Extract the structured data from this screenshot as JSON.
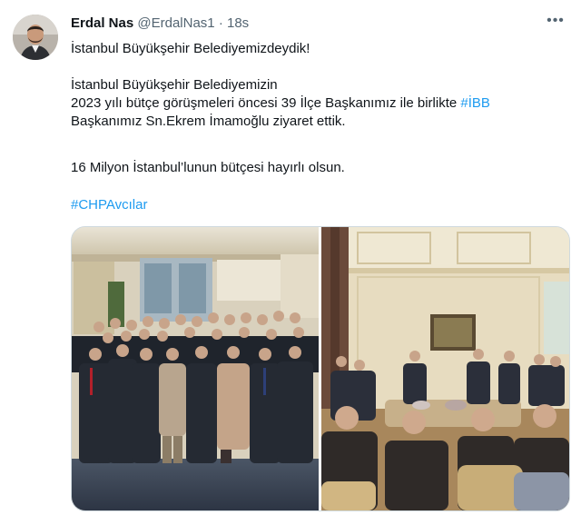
{
  "tweet": {
    "author_name": "Erdal Nas",
    "author_handle": "@ErdalNas1",
    "separator": "·",
    "timestamp": "18s",
    "more_label": "•••",
    "line1": "İstanbul Büyükşehir Belediyemizdeydik!",
    "line2a": "İstanbul Büyükşehir Belediyemizin",
    "line2b_prefix": "2023 yılı bütçe görüşmeleri öncesi 39 İlçe Başkanımız ile birlikte ",
    "line2b_hashtag": "#İBB",
    "line2c": "Başkanımız Sn.Ekrem İmamoğlu ziyaret ettik.",
    "line3": "16 Milyon İstanbul’lunun bütçesi hayırlı olsun.",
    "hashtag": "#CHPAvcılar"
  },
  "colors": {
    "text": "#0f1419",
    "secondary": "#536471",
    "link": "#1d9bf0",
    "border": "#cfd9de"
  },
  "icons": {
    "more": "more-horizontal-icon"
  }
}
